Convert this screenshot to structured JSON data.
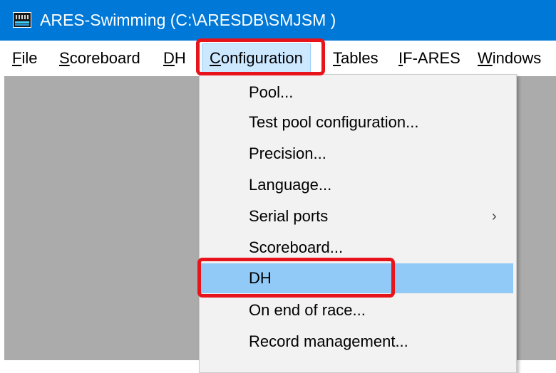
{
  "window": {
    "title": "ARES-Swimming (C:\\ARESDB\\SMJSM )",
    "app_icon": "ares-app-icon"
  },
  "menubar": {
    "items": [
      {
        "pre": "",
        "ul": "F",
        "post": "ile"
      },
      {
        "pre": "",
        "ul": "S",
        "post": "coreboard"
      },
      {
        "pre": "",
        "ul": "D",
        "post": "H"
      },
      {
        "pre": "",
        "ul": "C",
        "post": "onfiguration"
      },
      {
        "pre": "",
        "ul": "T",
        "post": "ables"
      },
      {
        "pre": "",
        "ul": "I",
        "post": "F-ARES"
      },
      {
        "pre": "",
        "ul": "W",
        "post": "indows"
      }
    ],
    "open_item": "Configuration"
  },
  "configuration_menu": {
    "items": [
      {
        "label": "Pool..."
      },
      {
        "label": "Test pool configuration..."
      },
      {
        "label": "Precision..."
      },
      {
        "label": "Language..."
      },
      {
        "label": "Serial ports",
        "submenu_arrow": "›"
      },
      {
        "label": "Scoreboard..."
      },
      {
        "label": "DH",
        "highlighted": true
      },
      {
        "label": "On end of race..."
      },
      {
        "label": "Record management..."
      }
    ]
  },
  "colors": {
    "titlebar": "#0078d7",
    "workspace": "#ababab",
    "menu_bg": "#f2f2f2",
    "highlight": "#91c9f7",
    "annotation_red": "#e8141c"
  }
}
